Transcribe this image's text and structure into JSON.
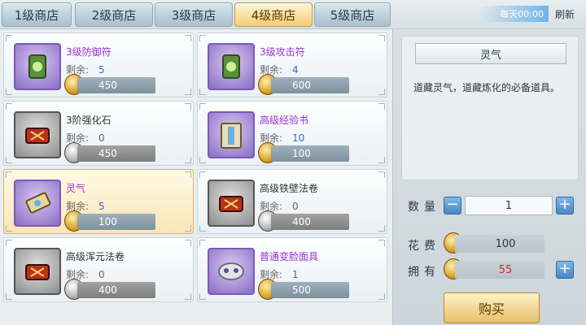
{
  "tabs": [
    {
      "label": "1级商店"
    },
    {
      "label": "2级商店"
    },
    {
      "label": "3级商店"
    },
    {
      "label": "4级商店"
    },
    {
      "label": "5级商店"
    }
  ],
  "active_tab": 3,
  "header": {
    "timer": "每天00:00",
    "refresh_label": "刷新"
  },
  "items": [
    {
      "name": "3级防御符",
      "remain_label": "剩余:",
      "remain": "5",
      "price": "450",
      "name_color": "purple",
      "icon": "amulet-icon",
      "coin": "gold"
    },
    {
      "name": "3级攻击符",
      "remain_label": "剩余:",
      "remain": "4",
      "price": "600",
      "name_color": "purple",
      "icon": "amulet-icon",
      "coin": "gold"
    },
    {
      "name": "3阶强化石",
      "remain_label": "剩余:",
      "remain": "0",
      "price": "450",
      "name_color": "normal",
      "icon": "stone-icon",
      "coin": "silver"
    },
    {
      "name": "高级经验书",
      "remain_label": "剩余:",
      "remain": "10",
      "price": "100",
      "name_color": "purple",
      "icon": "book-icon",
      "coin": "gold"
    },
    {
      "name": "灵气",
      "remain_label": "剩余:",
      "remain": "5",
      "price": "100",
      "name_color": "purple",
      "icon": "talisman-icon",
      "coin": "gold"
    },
    {
      "name": "高级铁壁法卷",
      "remain_label": "剩余:",
      "remain": "0",
      "price": "400",
      "name_color": "normal",
      "icon": "scroll-icon",
      "coin": "silver"
    },
    {
      "name": "高级浑元法卷",
      "remain_label": "剩余:",
      "remain": "0",
      "price": "400",
      "name_color": "normal",
      "icon": "scroll-icon",
      "coin": "silver"
    },
    {
      "name": "普通变脸面具",
      "remain_label": "剩余:",
      "remain": "1",
      "price": "500",
      "name_color": "purple",
      "icon": "mask-icon",
      "coin": "gold"
    }
  ],
  "detail": {
    "title": "灵气",
    "description": "道藏灵气，道藏炼化的必备道具。",
    "qty_label": "数量",
    "qty_value": "1",
    "cost_label": "花费",
    "cost_value": "100",
    "own_label": "拥有",
    "own_value": "55",
    "buy_label": "购买"
  }
}
